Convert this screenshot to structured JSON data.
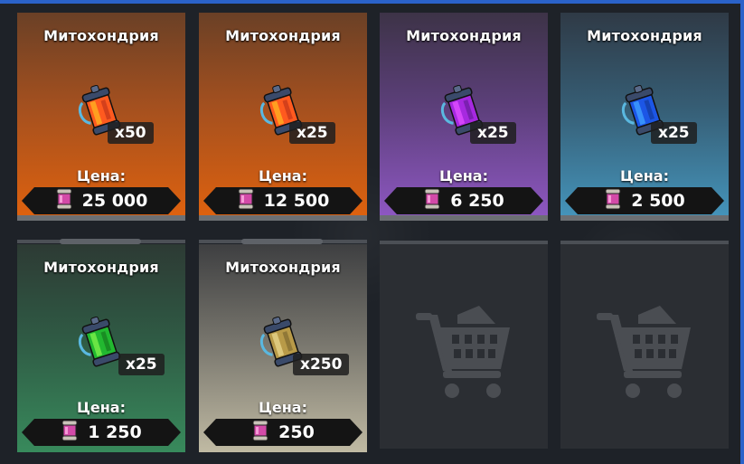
{
  "item_name": "Митохондрия",
  "price_label": "Цена:",
  "colors": {
    "orange": "#c4571a",
    "purple": "#7a47a6",
    "blue": "#3a8ab0",
    "green": "#2e7a4e",
    "beige": "#b3ad98",
    "frame": "#2a62c9"
  },
  "cards": [
    {
      "title": "Митохондрия",
      "qty": "x50",
      "price_label": "Цена:",
      "price": "25 000",
      "variant": "orange",
      "icon": "mitochondria-canister-icon-orange"
    },
    {
      "title": "Митохондрия",
      "qty": "x25",
      "price_label": "Цена:",
      "price": "12 500",
      "variant": "orange",
      "icon": "mitochondria-canister-icon-orange"
    },
    {
      "title": "Митохондрия",
      "qty": "x25",
      "price_label": "Цена:",
      "price": "6 250",
      "variant": "purple",
      "icon": "mitochondria-canister-icon-purple"
    },
    {
      "title": "Митохондрия",
      "qty": "x25",
      "price_label": "Цена:",
      "price": "2 500",
      "variant": "blue",
      "icon": "mitochondria-canister-icon-blue"
    },
    {
      "title": "Митохондрия",
      "qty": "x25",
      "price_label": "Цена:",
      "price": "1 250",
      "variant": "green",
      "icon": "mitochondria-canister-icon-green"
    },
    {
      "title": "Митохондрия",
      "qty": "x250",
      "price_label": "Цена:",
      "price": "250",
      "variant": "beige",
      "icon": "mitochondria-canister-icon-beige"
    }
  ],
  "empty_slots": [
    {
      "icon": "shopping-cart-icon"
    },
    {
      "icon": "shopping-cart-icon"
    }
  ]
}
